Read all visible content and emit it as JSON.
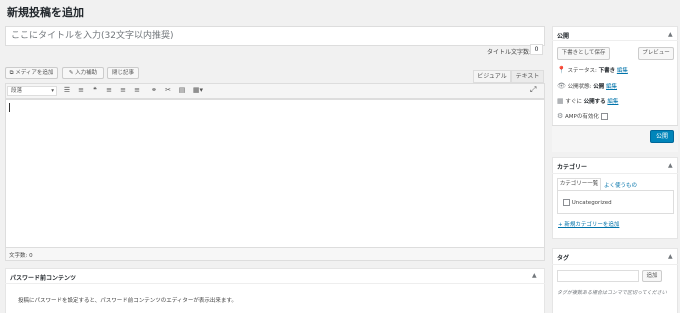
{
  "page": {
    "title": "新規投稿を追加"
  },
  "editor": {
    "title_placeholder": "ここにタイトルを入力(32文字以内推奨)",
    "title_counter_label": "タイトル文字数:",
    "title_counter_value": "0",
    "buttons": {
      "add_media": "メディアを追加",
      "input_support": "入力補助",
      "close_tags": "閉じ記事"
    },
    "tabs": {
      "visual": "ビジュアル",
      "text": "テキスト"
    },
    "format_select": "段落",
    "toolbar_icons": [
      "bulleted-list-icon",
      "numbered-list-icon",
      "blockquote-icon",
      "align-left-icon",
      "align-center-icon",
      "align-right-icon",
      "link-icon",
      "unlink-icon",
      "read-more-icon",
      "table-icon"
    ],
    "word_count": "文字数: 0"
  },
  "password_panel": {
    "title": "パスワード前コンテンツ",
    "description": "投稿にパスワードを設定すると、パスワード前コンテンツのエディターが表示出来ます。"
  },
  "publish": {
    "title": "公開",
    "save_draft": "下書きとして保存",
    "preview": "プレビュー",
    "status_label": "ステータス:",
    "status_value": "下書き",
    "status_edit": "編集",
    "visibility_label": "公開状態:",
    "visibility_value": "公開",
    "visibility_edit": "編集",
    "schedule_label": "すぐに",
    "schedule_value": "公開する",
    "schedule_edit": "編集",
    "amp_label": "AMPの有効化",
    "publish_button": "公開",
    "accent_color": "#0085ba"
  },
  "categories": {
    "title": "カテゴリー",
    "tab_all": "カテゴリー一覧",
    "tab_popular": "よく使うもの",
    "items": [
      "Uncategorized"
    ],
    "add_new": "+ 新規カテゴリーを追加"
  },
  "tags": {
    "title": "タグ",
    "add_button": "追加",
    "hint": "タグが複数ある場合はコンマで区切ってください"
  }
}
